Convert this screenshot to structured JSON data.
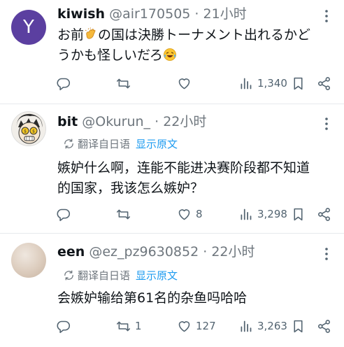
{
  "tweets": [
    {
      "name": "kiwish",
      "handle": "@air170505",
      "time": "21小时",
      "avatar_letter": "Y",
      "text_line1_a": "お前",
      "text_line1_b": "の国は決勝トーナメント出れるかど",
      "text_line2": "うかも怪しいだろ",
      "emoji1": "clap-hands-emoji",
      "emoji2": "laughing-tears-emoji",
      "replies": "",
      "retweets": "",
      "likes": "",
      "views": "1,340"
    },
    {
      "name": "bit",
      "handle": "@Okurun_",
      "time": "22小时",
      "translate_label": "翻译自日语",
      "translate_link": "显示原文",
      "text_line1": "嫉妒什么啊，连能不能进决赛阶段都不知道",
      "text_line2": "的国家，我该怎么嫉妒？",
      "replies": "",
      "retweets": "",
      "likes": "8",
      "views": "3,298"
    },
    {
      "name": "een",
      "handle": "@ez_pz9630852",
      "time": "22小时",
      "translate_label": "翻译自日语",
      "translate_link": "显示原文",
      "text_line1": "会嫉妒输给第61名的杂鱼吗哈哈",
      "replies": "",
      "retweets": "1",
      "likes": "127",
      "views": "3,263"
    }
  ],
  "separator": "·",
  "icons": {
    "reply": "reply-icon",
    "retweet": "retweet-icon",
    "like": "heart-icon",
    "views": "views-chart-icon",
    "bookmark": "bookmark-icon",
    "share": "share-icon",
    "more": "more-dots-icon",
    "translate": "translate-icon"
  },
  "colors": {
    "link": "#1d9bf0",
    "muted": "#6e767d",
    "text": "#0f1419"
  }
}
